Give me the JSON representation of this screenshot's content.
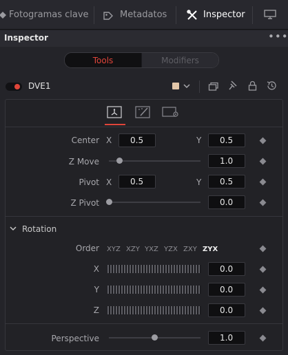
{
  "tabs": {
    "fotogramas": "Fotogramas clave",
    "metadatos": "Metadatos",
    "inspector": "Inspector"
  },
  "inspector_title": "Inspector",
  "segments": {
    "tools": "Tools",
    "modifiers": "Modifiers"
  },
  "node": {
    "name": "DVE1"
  },
  "params": {
    "center": {
      "label": "Center",
      "x_axis": "X",
      "x": "0.5",
      "y_axis": "Y",
      "y": "0.5"
    },
    "zmove": {
      "label": "Z Move",
      "value": "1.0",
      "level": 0.12
    },
    "pivot": {
      "label": "Pivot",
      "x_axis": "X",
      "x": "0.5",
      "y_axis": "Y",
      "y": "0.5"
    },
    "zpivot": {
      "label": "Z Pivot",
      "value": "0.0",
      "level": 0.0
    }
  },
  "rotation": {
    "header": "Rotation",
    "order_label": "Order",
    "orders": [
      "XYZ",
      "XZY",
      "YXZ",
      "YZX",
      "ZXY",
      "ZYX"
    ],
    "selected_order": "ZYX",
    "x_label": "X",
    "x_value": "0.0",
    "y_label": "Y",
    "y_value": "0.0",
    "z_label": "Z",
    "z_value": "0.0"
  },
  "perspective": {
    "label": "Perspective",
    "value": "1.0",
    "level": 0.5
  },
  "colors": {
    "accent_red": "#e0453a",
    "swatch": "#e2c6a8"
  }
}
